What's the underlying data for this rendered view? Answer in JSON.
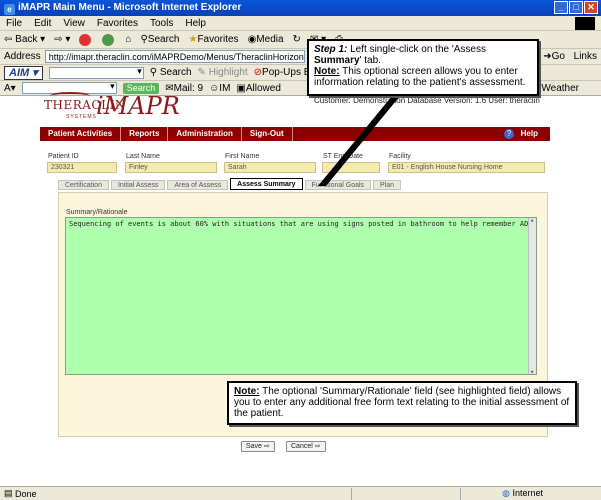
{
  "window": {
    "title": "iMAPR Main Menu - Microsoft Internet Explorer"
  },
  "menubar": [
    "File",
    "Edit",
    "View",
    "Favorites",
    "Tools",
    "Help"
  ],
  "toolbar": {
    "back": "Back",
    "search": "Search",
    "favorites": "Favorites",
    "media": "Media"
  },
  "address": {
    "label": "Address",
    "url": "http://imapr.theraclin.com/iMAPRDemo/Menus/TheraclinHorizontalMenu2.aspx",
    "go": "Go",
    "links": "Links"
  },
  "aimbar": {
    "aim": "AIM",
    "search": "Search",
    "highlight": "Highlight",
    "popups": "Pop-Ups Block"
  },
  "searchbar": {
    "search_btn": "Search",
    "mail": "Mail: 9",
    "im": "IM",
    "allowed": "Allowed",
    "weather": "Weather"
  },
  "header": {
    "logo_top": "THERACLIN",
    "logo_bottom": "SYSTEMS",
    "app_name": "iMAPR",
    "customer_line": "Customer: Demonstration Database Version: 1.6 User: theraclin"
  },
  "nav": {
    "items": [
      "Patient Activities",
      "Reports",
      "Administration",
      "Sign-Out"
    ],
    "help": "Help"
  },
  "patient": {
    "id_label": "Patient ID",
    "id_value": "230321",
    "last_label": "Last Name",
    "last_value": "Finley",
    "first_label": "First Name",
    "first_value": "Sarah",
    "st_end_label": "ST End Date",
    "st_end_value": "",
    "facility_label": "Facility",
    "facility_value": "E01 - English House Nursing Home"
  },
  "tabs": [
    "Certification",
    "Initial Assess",
    "Area of Assess",
    "Assess Summary",
    "Functional Goals",
    "Plan"
  ],
  "summary": {
    "label": "Summary/Rationale",
    "text": "Sequencing of events is about 60% with situations that are using signs posted in bathroom to help remember ADL's."
  },
  "buttons": {
    "save": "Save",
    "cancel": "Cancel"
  },
  "callout1": {
    "step_prefix": "Step 1:",
    "step_text_a": " Left single-click on the 'Assess ",
    "step_bold": "Summary",
    "step_text_b": "' tab.",
    "note_label": "Note:",
    "note_text": " This optional screen allows you to enter information relating to the patient's assessment."
  },
  "callout2": {
    "note_label": "Note:",
    "note_text": " The optional 'Summary/Rationale' field (see highlighted field) allows you to enter any additional free form text relating to the initial assessment of the patient."
  },
  "status": {
    "left": "Done",
    "zone": "Internet"
  }
}
